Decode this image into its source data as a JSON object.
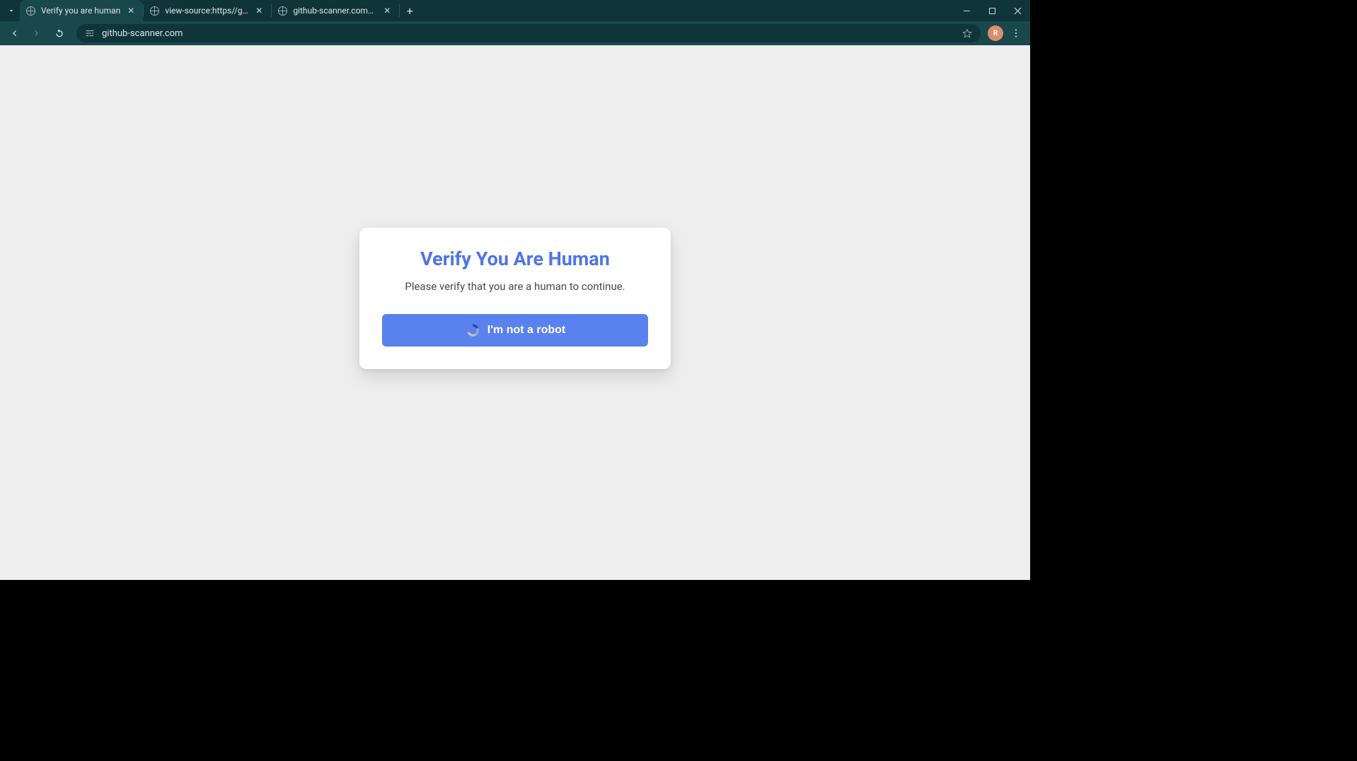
{
  "browser": {
    "tabs": [
      {
        "title": "Verify you are human",
        "active": true
      },
      {
        "title": "view-source:https//github-scan",
        "active": false
      },
      {
        "title": "github-scanner.com/download",
        "active": false
      }
    ],
    "url": "github-scanner.com",
    "avatar_initial": "R"
  },
  "page": {
    "heading": "Verify You Are Human",
    "subtext": "Please verify that you are a human to continue.",
    "button_label": "I'm not a robot"
  }
}
